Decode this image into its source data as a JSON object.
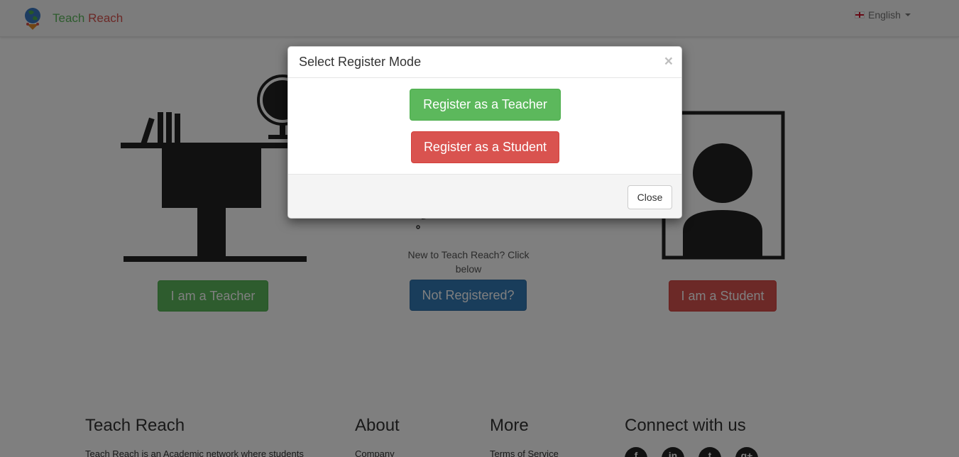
{
  "navbar": {
    "brand_first": "Teach",
    "brand_second": "Reach",
    "language": "English"
  },
  "main": {
    "teacher_button": "I am a Teacher",
    "hint_text": "New to Teach Reach? Click below",
    "not_registered_button": "Not Registered?",
    "student_button": "I am a Student"
  },
  "footer": {
    "col1_heading": "Teach Reach",
    "col1_text": "Teach Reach is an Academic network where students",
    "col2_heading": "About",
    "col2_link": "Company",
    "col3_heading": "More",
    "col3_link": "Terms of Service",
    "col4_heading": "Connect with us",
    "social_icons": [
      "facebook-icon",
      "linkedin-icon",
      "twitter-icon",
      "google-plus-icon"
    ],
    "social_glyphs": [
      "f",
      "in",
      "t",
      "g+"
    ]
  },
  "modal": {
    "title": "Select Register Mode",
    "close_x": "×",
    "register_teacher": "Register as a Teacher",
    "register_student": "Register as a Student",
    "close_button": "Close"
  },
  "colors": {
    "green": "#5cb85c",
    "red": "#d9534f",
    "blue": "#337ab7"
  }
}
